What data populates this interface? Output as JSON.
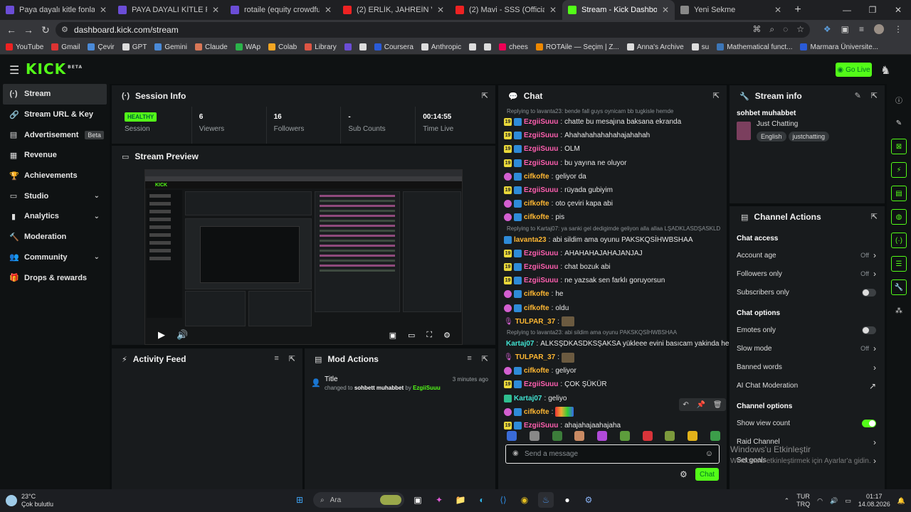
{
  "browser": {
    "tabs": [
      {
        "title": "Paya dayalı kitle fonlaması - Kit",
        "color": "#6b4dd6"
      },
      {
        "title": "PAYA DAYALI KİTLE FONLAMASI",
        "color": "#6b4dd6"
      },
      {
        "title": "rotaile (equity crowdfunding)",
        "color": "#6b4dd6"
      },
      {
        "title": "(2) ERLİK, JAHREİN VE ALPER Ç",
        "color": "#e22"
      },
      {
        "title": "(2) Mavi - SSS (Official Music V",
        "color": "#e22"
      },
      {
        "title": "Stream - Kick Dashboard",
        "color": "#53fc18",
        "active": true
      },
      {
        "title": "Yeni Sekme",
        "color": "#888"
      }
    ],
    "url": "dashboard.kick.com/stream",
    "bookmarks": [
      "YouTube",
      "Gmail",
      "Çevir",
      "GPT",
      "Gemini",
      "Claude",
      "WAp",
      "Colab",
      "Library",
      "",
      "",
      "Coursera",
      "Anthropic",
      "",
      "",
      "chees",
      "ROTAile — Seçim | Z...",
      "Anna's Archive",
      "su",
      "Mathematical funct...",
      "Marmara Üniversite..."
    ]
  },
  "header": {
    "logo": "KICK",
    "logo_sup": "BETA",
    "go_live": "Go Live"
  },
  "sidebar": {
    "items": [
      {
        "label": "Stream",
        "icon": "(·)",
        "active": true
      },
      {
        "label": "Stream URL & Key",
        "icon": "🔗"
      },
      {
        "label": "Advertisement",
        "icon": "▤",
        "badge": "Beta"
      },
      {
        "label": "Revenue",
        "icon": "▦"
      },
      {
        "label": "Achievements",
        "icon": "🏆"
      },
      {
        "label": "Studio",
        "icon": "▭",
        "chevron": true
      },
      {
        "label": "Analytics",
        "icon": "▮",
        "chevron": true
      },
      {
        "label": "Moderation",
        "icon": "🔨"
      },
      {
        "label": "Community",
        "icon": "👥",
        "chevron": true
      },
      {
        "label": "Drops & rewards",
        "icon": "🎁"
      }
    ]
  },
  "session": {
    "title": "Session Info",
    "cells": [
      {
        "value": "HEALTHY",
        "label": "Session",
        "badge": true
      },
      {
        "value": "6",
        "label": "Viewers"
      },
      {
        "value": "16",
        "label": "Followers"
      },
      {
        "value": "-",
        "label": "Sub Counts"
      },
      {
        "value": "00:14:55",
        "label": "Time Live"
      }
    ]
  },
  "preview": {
    "title": "Stream Preview"
  },
  "activity": {
    "title": "Activity Feed"
  },
  "mod_actions": {
    "title": "Mod Actions",
    "entry": {
      "title": "Title",
      "time": "3 minutes ago",
      "pre": "changed to ",
      "value": "sohbett muhabbet",
      "by": " by ",
      "user": "EzgiiSuuu"
    }
  },
  "chat": {
    "title": "Chat",
    "messages": [
      {
        "reply": "Replying to lavanta23: bende fall guys oynicam bb tugkisle hemde"
      },
      {
        "badges": [
          "19",
          "sw"
        ],
        "user": "EzgiiSuuu",
        "uc": "u-pink",
        "text": "chatte bu mesajına baksana ekranda"
      },
      {
        "badges": [
          "19",
          "sw"
        ],
        "user": "EzgiiSuuu",
        "uc": "u-pink",
        "text": "Ahahahahahahahajahahah"
      },
      {
        "badges": [
          "19",
          "sw"
        ],
        "user": "EzgiiSuuu",
        "uc": "u-pink",
        "text": "OLM"
      },
      {
        "badges": [
          "19",
          "sw"
        ],
        "user": "EzgiiSuuu",
        "uc": "u-pink",
        "text": "bu yayına ne oluyor"
      },
      {
        "badges": [
          "sub",
          "sw"
        ],
        "user": "cifkofte",
        "uc": "u-orange",
        "text": "geliyor da"
      },
      {
        "badges": [
          "19",
          "sw"
        ],
        "user": "EzgiiSuuu",
        "uc": "u-pink",
        "text": "rüyada gubiyim"
      },
      {
        "badges": [
          "sub",
          "sw"
        ],
        "user": "cifkofte",
        "uc": "u-orange",
        "text": "oto çeviri kapa abi"
      },
      {
        "badges": [
          "sub",
          "sw"
        ],
        "user": "cifkofte",
        "uc": "u-orange",
        "text": "pis"
      },
      {
        "reply": "Replying to Kartaj07: ya sanki gel dedigimde geliyon alla allaa LŞADKLASDŞASKLD"
      },
      {
        "badges": [
          "sw"
        ],
        "user": "lavanta23",
        "uc": "u-orange",
        "text": "abi sildim ama oyunu PAKSKQSİHWBSHAA"
      },
      {
        "badges": [
          "19",
          "sw"
        ],
        "user": "EzgiiSuuu",
        "uc": "u-pink",
        "text": "AHAHAHAJAHAJANJAJ"
      },
      {
        "badges": [
          "19",
          "sw"
        ],
        "user": "EzgiiSuuu",
        "uc": "u-pink",
        "text": "chat bozuk abi"
      },
      {
        "badges": [
          "19",
          "sw"
        ],
        "user": "EzgiiSuuu",
        "uc": "u-pink",
        "text": "ne yazsak sen farklı goruyorsun"
      },
      {
        "badges": [
          "sub",
          "sw"
        ],
        "user": "cifkofte",
        "uc": "u-orange",
        "text": "he"
      },
      {
        "badges": [
          "sub",
          "sw"
        ],
        "user": "cifkofte",
        "uc": "u-orange",
        "text": "oldu"
      },
      {
        "badges": [
          "mic"
        ],
        "user": "TULPAR_37",
        "uc": "u-orange",
        "text": "",
        "emote": "e1"
      },
      {
        "reply": "Replying to lavanta23: abi sildim ama oyunu PAKSKQSİHWBSHAA"
      },
      {
        "badges": [
          "sw"
        ],
        "user": "Kartaj07",
        "uc": "u-teal",
        "text": "ALKSŞDKASDKSŞAKSA yükleee evini basıcam yakinda he"
      },
      {
        "badges": [
          "mic"
        ],
        "user": "TULPAR_37",
        "uc": "u-orange",
        "text": "",
        "emote": "e1"
      },
      {
        "badges": [
          "sub",
          "sw"
        ],
        "user": "cifkofte",
        "uc": "u-orange",
        "text": "geliyor"
      },
      {
        "badges": [
          "19",
          "sw"
        ],
        "user": "EzgiiSuuu",
        "uc": "u-pink",
        "text": "ÇOK ŞÜKÜR"
      },
      {
        "badges": [
          "gr"
        ],
        "user": "Kartaj07",
        "uc": "u-teal",
        "text": "geliyo"
      },
      {
        "badges": [
          "sub",
          "sw"
        ],
        "user": "cifkofte",
        "uc": "u-orange",
        "text": "",
        "emote": "e2"
      },
      {
        "badges": [
          "19",
          "sw"
        ],
        "user": "EzgiiSuuu",
        "uc": "u-pink",
        "text": "ahajahajaahajaha"
      }
    ],
    "emote_colors": [
      "#3a6bd8",
      "#888",
      "#3c7d3a",
      "#c98a63",
      "#b04ad8",
      "#5d9d3c",
      "#d8343a",
      "#7c9a3c",
      "#e2b21a",
      "#3c9e4a"
    ],
    "placeholder": "Send a message",
    "send_label": "Chat"
  },
  "stream_info": {
    "title": "Stream info",
    "stream_title": "sohbet muhabbet",
    "category": "Just Chatting",
    "tags": [
      "English",
      "justchatting"
    ]
  },
  "channel_actions": {
    "title": "Channel Actions",
    "sections": [
      {
        "heading": "Chat access",
        "rows": [
          {
            "label": "Account age",
            "value": "Off",
            "type": "chev"
          },
          {
            "label": "Followers only",
            "value": "Off",
            "type": "chev"
          },
          {
            "label": "Subscribers only",
            "type": "toggle",
            "on": false
          }
        ]
      },
      {
        "heading": "Chat options",
        "rows": [
          {
            "label": "Emotes only",
            "type": "toggle",
            "on": false
          },
          {
            "label": "Slow mode",
            "value": "Off",
            "type": "chev"
          },
          {
            "label": "Banned words",
            "type": "chev"
          },
          {
            "label": "AI Chat Moderation",
            "type": "ext"
          }
        ]
      },
      {
        "heading": "Channel options",
        "rows": [
          {
            "label": "Show view count",
            "type": "toggle",
            "on": true
          },
          {
            "label": "Raid Channel",
            "type": "chev"
          },
          {
            "label": "Set goals",
            "type": "chev"
          }
        ]
      }
    ]
  },
  "windows": {
    "activate_title": "Windows'u Etkinleştir",
    "activate_sub": "Windows'u etkinleştirmek için Ayarlar'a gidin.",
    "weather_temp": "23°C",
    "weather_desc": "Çok bulutlu",
    "search": "Ara",
    "lang": "TUR",
    "lang2": "TRQ",
    "time": "01:17",
    "date": "14.08.2026"
  }
}
